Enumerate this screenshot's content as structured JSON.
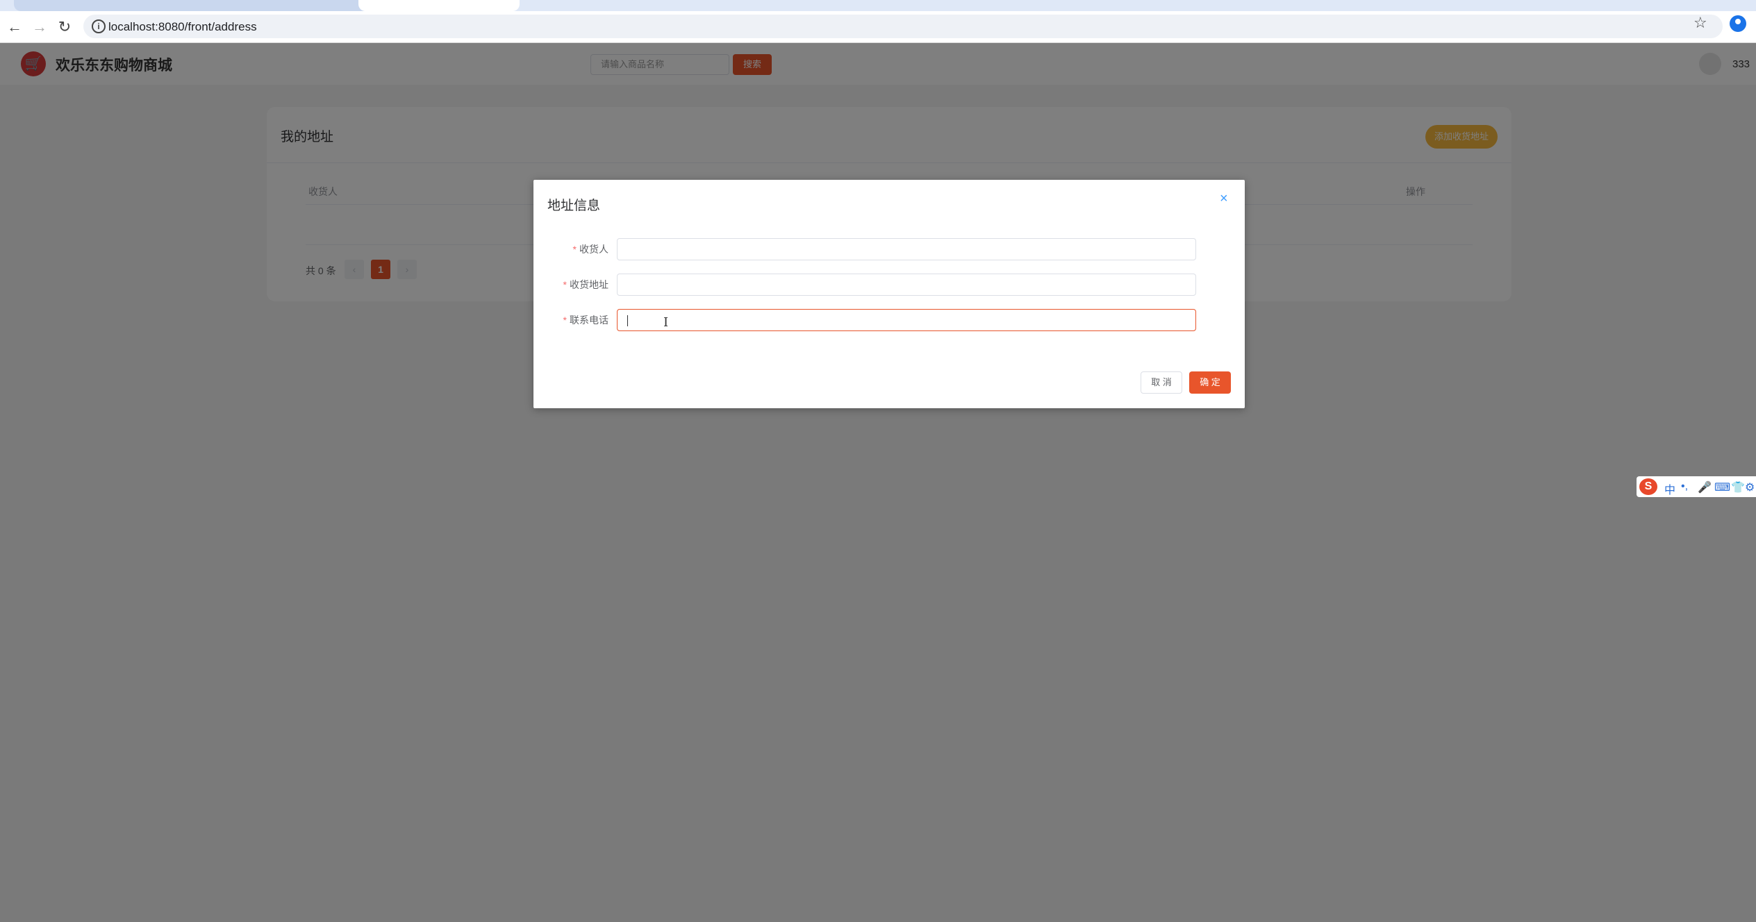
{
  "browser": {
    "tabs": [
      "",
      "",
      ""
    ],
    "url": "localhost:8080/front/address"
  },
  "header": {
    "site_title": "欢乐东东购物商城",
    "search_placeholder": "请输入商品名称",
    "search_button": "搜索",
    "username": "333"
  },
  "address_page": {
    "title": "我的地址",
    "add_button": "添加收货地址",
    "columns": [
      "收货人",
      "操作"
    ],
    "total": "共 0 条",
    "current_page": "1",
    "prev": "‹",
    "next": "›"
  },
  "dialog": {
    "title": "地址信息",
    "close": "×",
    "fields": [
      {
        "label": "收货人",
        "value": ""
      },
      {
        "label": "收货地址",
        "value": ""
      },
      {
        "label": "联系电话",
        "value": ""
      }
    ],
    "cancel": "取 消",
    "confirm": "确 定"
  },
  "ime": {
    "logo": "S",
    "items": [
      "中",
      "•,",
      "🎤",
      "⌨",
      "👕",
      "⚙"
    ]
  }
}
